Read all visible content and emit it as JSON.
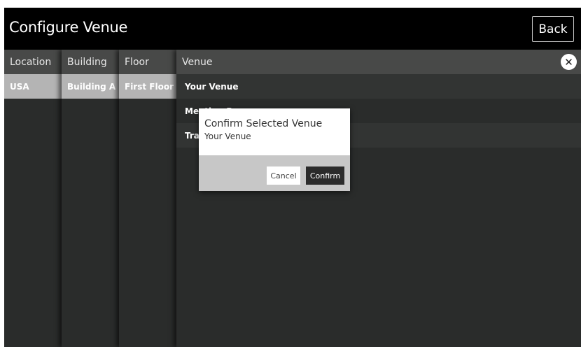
{
  "header": {
    "title": "Configure Venue",
    "back_label": "Back"
  },
  "columns": {
    "location": {
      "label": "Location",
      "items": [
        "USA"
      ]
    },
    "building": {
      "label": "Building",
      "items": [
        "Building A"
      ]
    },
    "floor": {
      "label": "Floor",
      "items": [
        "First Floor"
      ]
    },
    "venue": {
      "label": "Venue",
      "items": [
        "Your Venue",
        "Meeting Room",
        "Training Room"
      ]
    }
  },
  "icons": {
    "close": "close-icon"
  },
  "modal": {
    "title": "Confirm Selected Venue",
    "subtitle": "Your Venue",
    "cancel_label": "Cancel",
    "confirm_label": "Confirm"
  },
  "colors": {
    "header_bg": "#000000",
    "panel_bg": "#2a2c2b",
    "column_header_bg": "#484948",
    "selected_bg": "#b4b4b4",
    "confirm_bg": "#2b2b2b"
  }
}
